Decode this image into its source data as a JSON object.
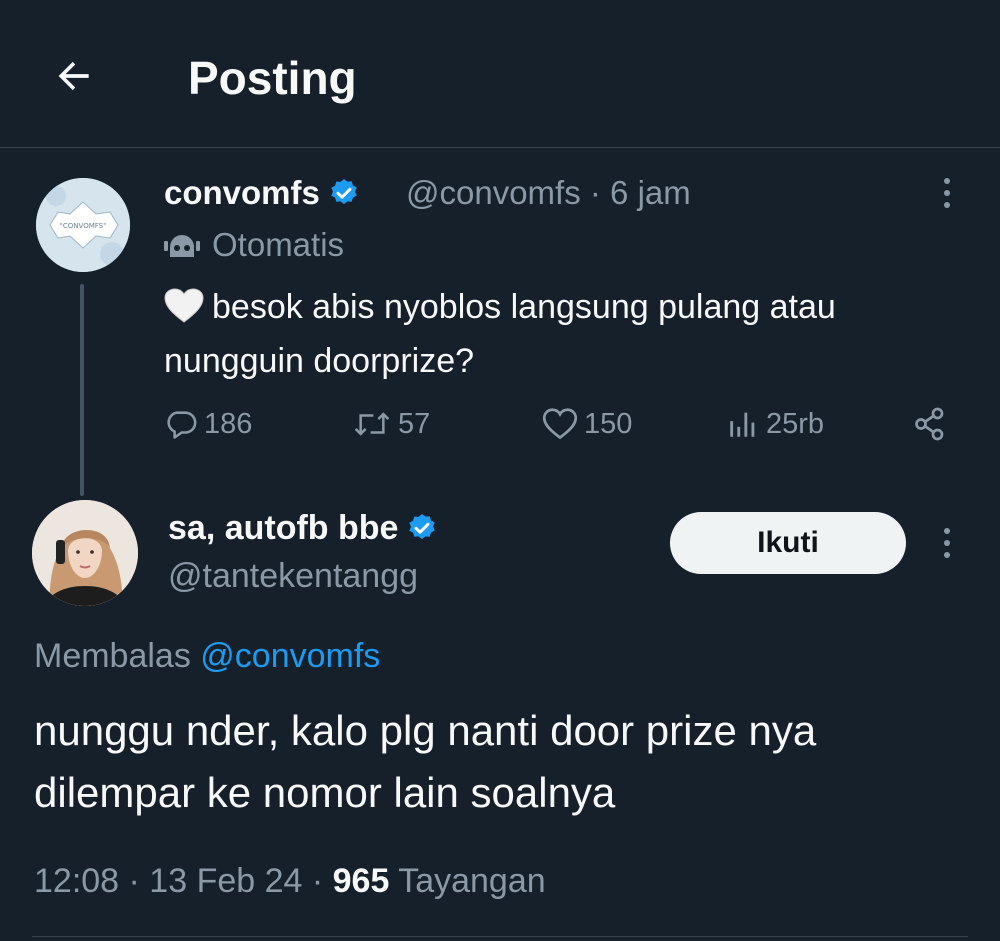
{
  "header": {
    "title": "Posting",
    "back_icon": "arrow-left-icon"
  },
  "parent_post": {
    "avatar_text": "\"CONVOMFS\"",
    "display_name": "convomfs",
    "handle": "@convomfs",
    "time": "6 jam",
    "meta": "@convomfs · 6 jam",
    "automated_label": "Otomatis",
    "text": "besok abis nyoblos langsung pulang atau nungguin doorprize?",
    "emoji": "white-heart",
    "actions": {
      "replies": "186",
      "reposts": "57",
      "likes": "150",
      "views": "25rb"
    }
  },
  "reply_post": {
    "display_name": "sa, autofb bbe",
    "handle": "@tantekentangg",
    "follow_label": "Ikuti",
    "replying_prefix": "Membalas",
    "replying_to": "@convomfs",
    "text": "nunggu nder, kalo plg nanti door prize nya dilempar ke nomor lain soalnya",
    "timestamp": "12:08 · 13 Feb 24 · ",
    "views_count": "965",
    "views_label": " Tayangan"
  },
  "colors": {
    "background": "#15202b",
    "text_primary": "#f7f9f9",
    "text_secondary": "#8b98a5",
    "accent": "#1d9bf0",
    "divider": "#38444d"
  }
}
